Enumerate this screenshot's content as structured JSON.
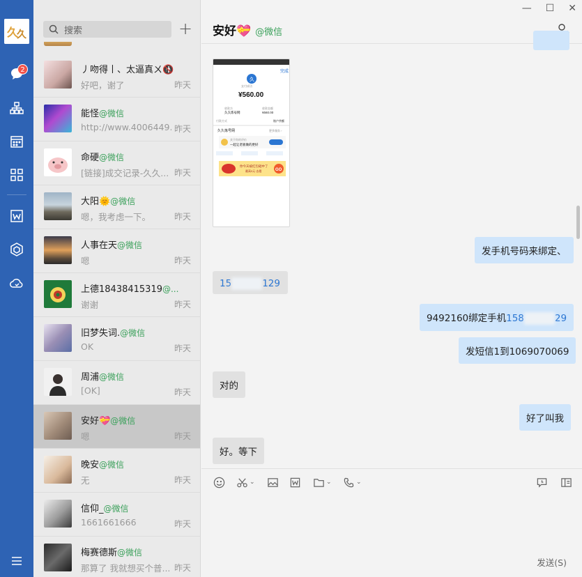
{
  "rail": {
    "badge_count": "2",
    "nav_icons": [
      "chat-icon",
      "org-chart-icon",
      "calendar-icon",
      "apps-grid-icon",
      "document-icon",
      "hexagon-app-icon",
      "cloud-drive-icon",
      "menu-icon"
    ]
  },
  "list": {
    "search_placeholder": "搜索",
    "contacts": [
      {
        "name": "丿吻得丨、太逼真ㄨ🚯",
        "tag": "",
        "msg": "好吧，谢了",
        "time": "昨天"
      },
      {
        "name": "能怪",
        "tag": "@微信",
        "msg": "http://www.4006449...",
        "time": "昨天"
      },
      {
        "name": "命硬",
        "tag": "@微信",
        "msg": "[链接]成交记录-久久...",
        "time": "昨天"
      },
      {
        "name": "大阳🌞",
        "tag": "@微信",
        "msg": "嗯，我考虑一下。",
        "time": "昨天"
      },
      {
        "name": "人事在天",
        "tag": "@微信",
        "msg": "嗯",
        "time": "昨天"
      },
      {
        "name": "上德18438415319",
        "tag": "@...",
        "msg": "谢谢",
        "time": "昨天"
      },
      {
        "name": "旧梦失词.",
        "tag": "@微信",
        "msg": "OK",
        "time": "昨天"
      },
      {
        "name": "周浦",
        "tag": "@微信",
        "msg": "[OK]",
        "time": "昨天"
      },
      {
        "name": "安好💝",
        "tag": "@微信",
        "msg": "嗯",
        "time": "昨天"
      },
      {
        "name": "晚安",
        "tag": "@微信",
        "msg": "无",
        "time": "昨天"
      },
      {
        "name": "信仰_",
        "tag": "@微信",
        "msg": "1661661666",
        "time": "昨天"
      },
      {
        "name": "梅赛德斯",
        "tag": "@微信",
        "msg": "那算了 我就想买个普...",
        "time": "昨天"
      }
    ]
  },
  "chat": {
    "title": "安好💝",
    "title_tag": "@微信",
    "screenshot_amount": "¥560.00",
    "screenshot_done": "完成",
    "screenshot_game": "久久炼号网",
    "screenshot_go": "GO",
    "messages": [
      {
        "text": "发手机号码来绑定、"
      },
      {
        "prefix": "15",
        "suffix": "129"
      },
      {
        "plain": "9492160绑定手机",
        "prefix": "158",
        "suffix": "29"
      },
      {
        "text": "发短信1到1069070069"
      },
      {
        "text": "对的"
      },
      {
        "text": "好了叫我"
      },
      {
        "text": "好。等下"
      }
    ],
    "send_label": "发送(S)"
  }
}
